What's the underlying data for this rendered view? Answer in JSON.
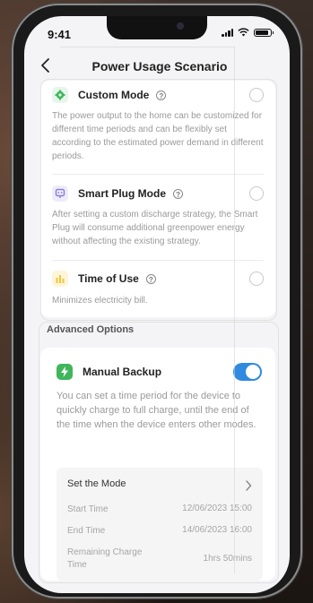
{
  "status": {
    "time": "9:41"
  },
  "header": {
    "title": "Power Usage Scenario"
  },
  "options": [
    {
      "title": "Custom Mode",
      "icon": "gear-icon",
      "color": "#3fb65a",
      "description": "The power output to the home can be customized for different time periods and can be flexibly set according to the estimated power demand in different periods."
    },
    {
      "title": "Smart Plug Mode",
      "icon": "smart-plug-icon",
      "color": "#8a7fd6",
      "description": "After setting a custom discharge strategy, the Smart Plug will consume additional greenpower energy without affecting the existing strategy."
    },
    {
      "title": "Time of Use",
      "icon": "bar-chart-icon",
      "color": "#f2c53a",
      "description": "Minimizes electricity bill."
    }
  ],
  "advanced": {
    "label": "Advanced Options",
    "manual_backup": {
      "title": "Manual Backup",
      "icon": "lightning-icon",
      "enabled": true,
      "description": "You can set a time period for the device to quickly charge to full charge, until the end of the time when the device enters other modes."
    },
    "mode": {
      "title": "Set the Mode",
      "rows": [
        {
          "label": "Start Time",
          "value": "12/06/2023 15:00"
        },
        {
          "label": "End Time",
          "value": "14/06/2023 16:00"
        },
        {
          "label": "Remaining Charge Time",
          "value": "1hrs 50mins"
        }
      ]
    }
  }
}
